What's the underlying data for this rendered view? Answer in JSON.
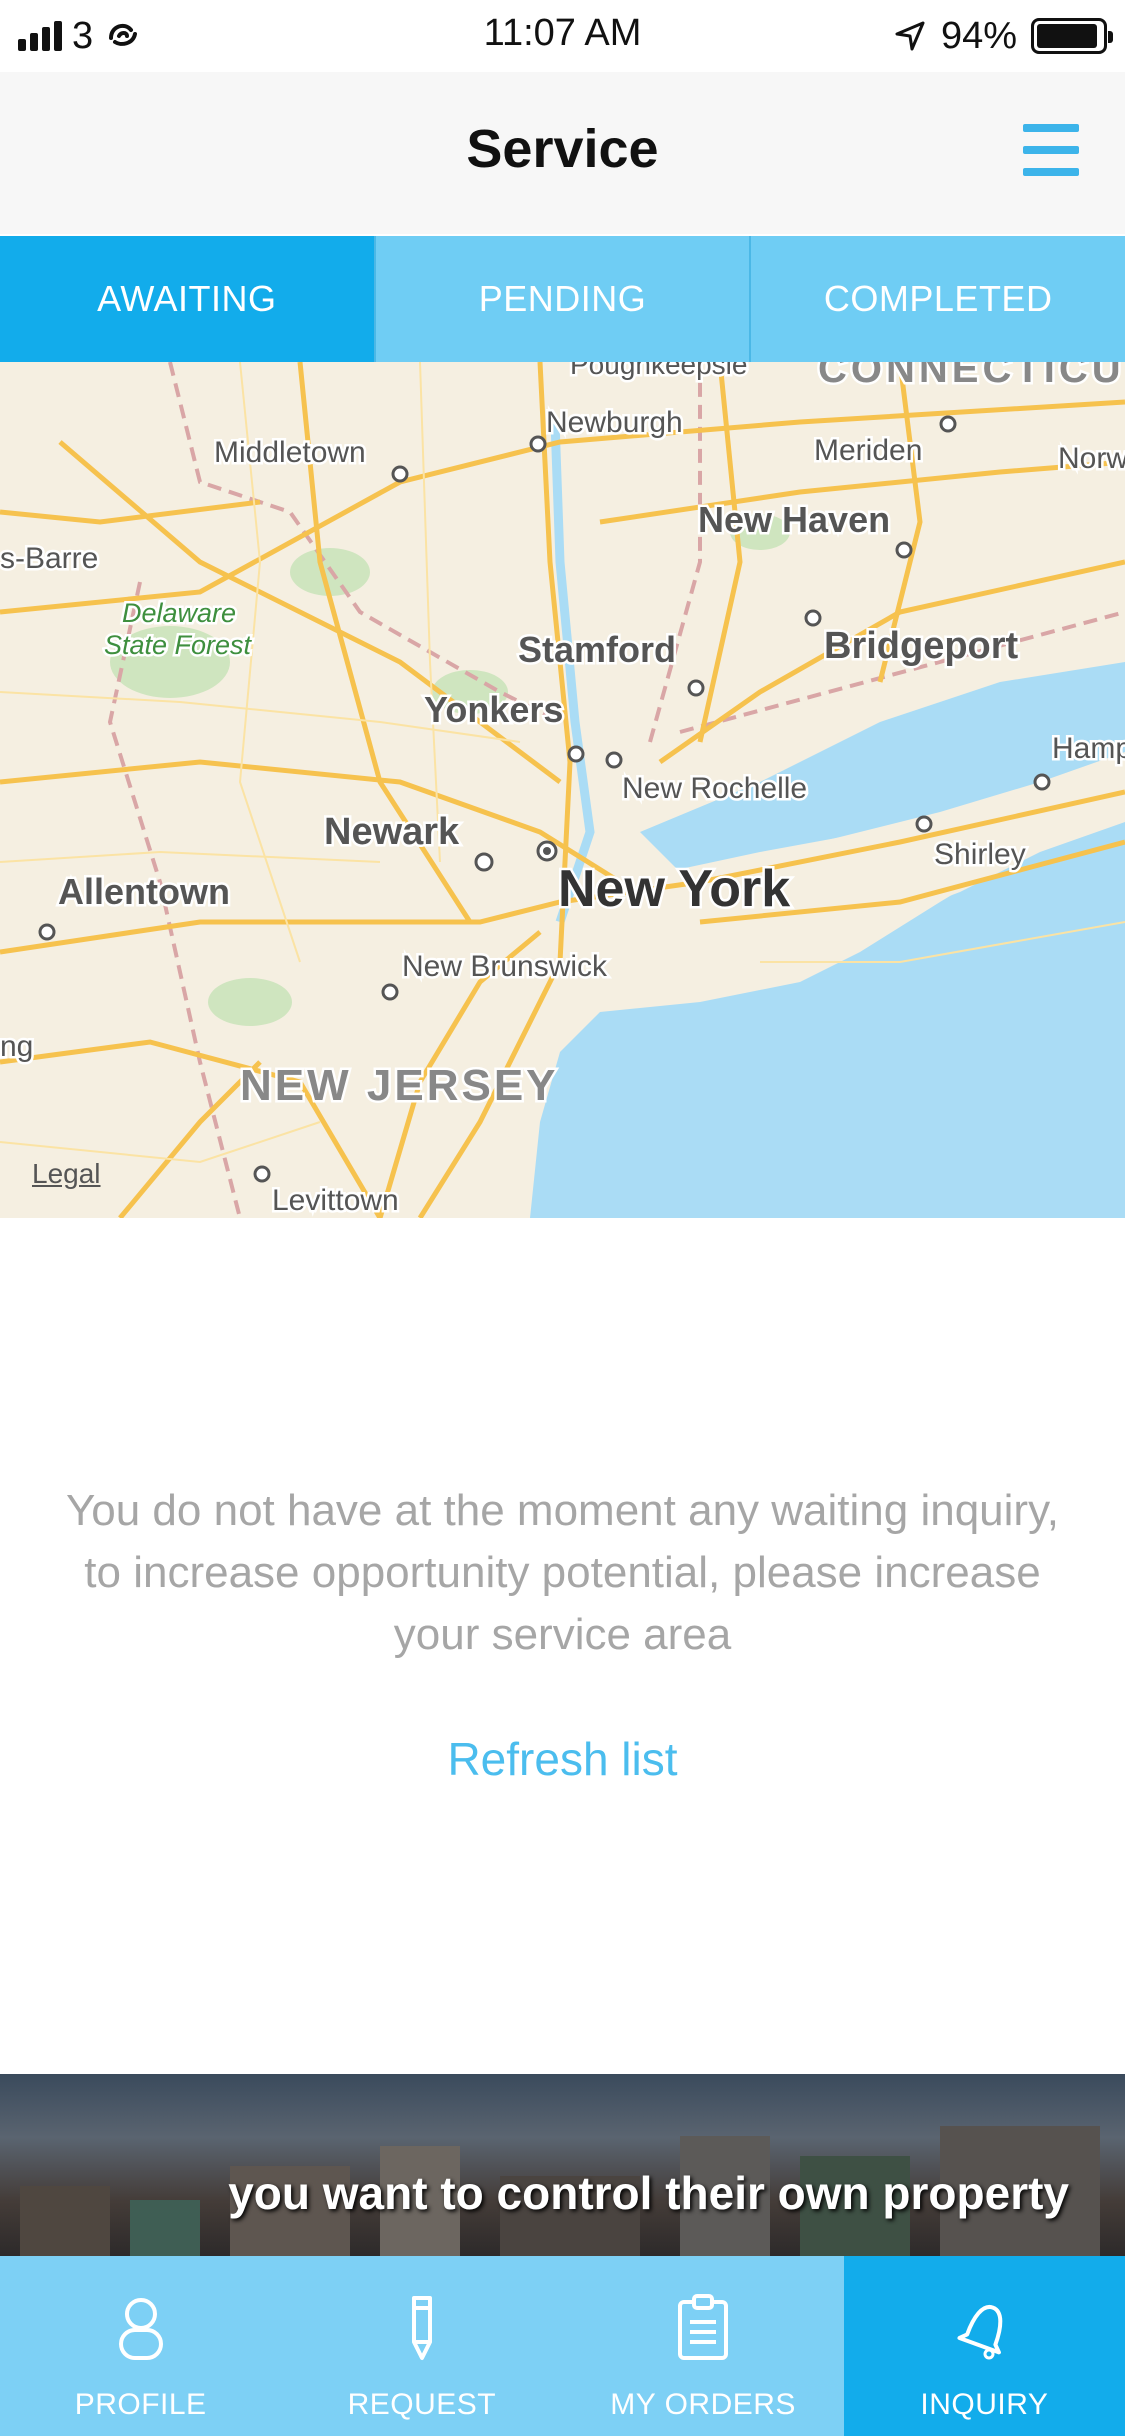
{
  "status_bar": {
    "carrier": "3",
    "time": "11:07 AM",
    "battery_percent": "94%",
    "battery_level": 0.94
  },
  "header": {
    "title": "Service"
  },
  "tabs": [
    {
      "label": "AWAITING",
      "active": true
    },
    {
      "label": "PENDING",
      "active": false
    },
    {
      "label": "COMPLETED",
      "active": false
    }
  ],
  "map": {
    "labels": {
      "middletown": "Middletown",
      "newburgh": "Newburgh",
      "meriden": "Meriden",
      "norw": "Norw",
      "barre": "s-Barre",
      "new_haven": "New Haven",
      "forest_1": "Delaware",
      "forest_2": "State Forest",
      "stamford": "Stamford",
      "bridgeport": "Bridgeport",
      "yonkers": "Yonkers",
      "hamp": "Hamp",
      "new_rochelle": "New Rochelle",
      "newark": "Newark",
      "shirley": "Shirley",
      "allentown": "Allentown",
      "new_york": "New York",
      "new_brunswick": "New Brunswick",
      "ng": "ng",
      "new_jersey": "NEW JERSEY",
      "levittown": "Levittown",
      "poughkeepsie": "Poughkeepsie",
      "connecticut": "CONNECTICU"
    },
    "legal": "Legal"
  },
  "empty_state": {
    "message": "You do not have at the moment any waiting inquiry, to increase opportunity potential, please increase your service area",
    "refresh_label": "Refresh list"
  },
  "banner": {
    "text": "you want to control their own property"
  },
  "tab_bar": [
    {
      "label": "PROFILE",
      "icon": "person-icon",
      "active": false
    },
    {
      "label": "REQUEST",
      "icon": "pencil-icon",
      "active": false
    },
    {
      "label": "MY ORDERS",
      "icon": "clipboard-icon",
      "active": false
    },
    {
      "label": "INQUIRY",
      "icon": "bell-icon",
      "active": true
    }
  ],
  "colors": {
    "accent": "#12aceb",
    "accent_light": "#6fcdf4",
    "water": "#aadcf5",
    "land": "#f5efe1",
    "road": "#f6c24e"
  }
}
